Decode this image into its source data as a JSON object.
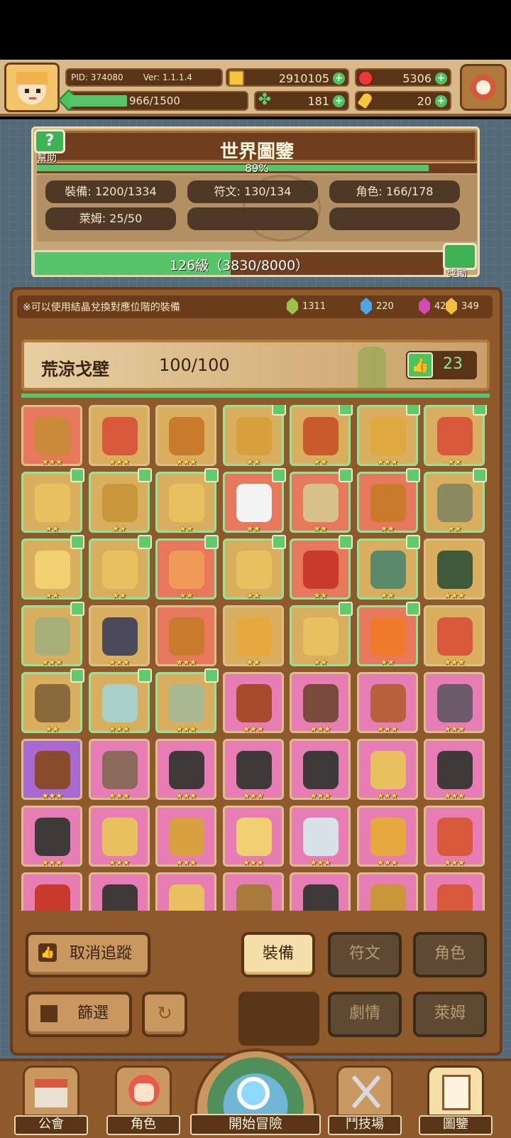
{
  "header": {
    "pid": "PID: 374080",
    "version": "Ver: 1.1.1.4",
    "exp": "966/1500",
    "gold": "2910105",
    "ruby": "5306",
    "clover": "181",
    "keys": "20"
  },
  "book": {
    "help_label": "幫助",
    "title": "世界圖鑒",
    "percent_text": "89%",
    "percent": 0.89,
    "stats": {
      "equipment": "裝備: 1200/1334",
      "runes": "符文: 130/134",
      "characters": "角色: 166/178",
      "slimes": "萊姆: 25/50"
    },
    "level_text": "126級（3830/8000）",
    "level_progress": 0.479,
    "reward_label": "獎勵"
  },
  "collection": {
    "notice": "※可以使用結晶兌換對應位階的裝備",
    "crystals": [
      {
        "color": "#9ac24a",
        "count": "1311"
      },
      {
        "color": "#4aa8e8",
        "count": "220"
      },
      {
        "color": "#d24ab4",
        "count": "42"
      },
      {
        "color": "#f0c040",
        "count": "349"
      }
    ],
    "area_name": "荒涼戈壁",
    "area_progress": "100/100",
    "likes": "23"
  },
  "grid": {
    "rows": [
      [
        {
          "bg": "#e8785c",
          "art": "#c98a3c",
          "stars": "★★★",
          "tracked": false
        },
        {
          "bg": "#d9ae5e",
          "art": "#d8583c",
          "stars": "★★★",
          "tracked": false
        },
        {
          "bg": "#d9ae5e",
          "art": "#c97a2c",
          "stars": "★★★",
          "tracked": false
        },
        {
          "bg": "#d9ae5e",
          "art": "#d8a03c",
          "stars": "★★",
          "tracked": true
        },
        {
          "bg": "#d9ae5e",
          "art": "#c85a2c",
          "stars": "★★",
          "tracked": true
        },
        {
          "bg": "#d9ae5e",
          "art": "#e0a840",
          "stars": "★★★",
          "tracked": true
        },
        {
          "bg": "#d9ae5e",
          "art": "#d8583c",
          "stars": "★★",
          "tracked": true
        }
      ],
      [
        {
          "bg": "#d9ae5e",
          "art": "#e8c060",
          "stars": "★★",
          "tracked": true
        },
        {
          "bg": "#d9ae5e",
          "art": "#c9963c",
          "stars": "★★",
          "tracked": true
        },
        {
          "bg": "#d9ae5e",
          "art": "#e8c060",
          "stars": "★★",
          "tracked": true
        },
        {
          "bg": "#e8785c",
          "art": "#f4f4f4",
          "stars": "★★",
          "tracked": true
        },
        {
          "bg": "#e8785c",
          "art": "#d8c08a",
          "stars": "★★",
          "tracked": true
        },
        {
          "bg": "#e8785c",
          "art": "#c97a2c",
          "stars": "★★",
          "tracked": true
        },
        {
          "bg": "#d9ae5e",
          "art": "#8a8a60",
          "stars": "★★",
          "tracked": true
        }
      ],
      [
        {
          "bg": "#d9ae5e",
          "art": "#f0d070",
          "stars": "★★",
          "tracked": true
        },
        {
          "bg": "#d9ae5e",
          "art": "#e8c060",
          "stars": "★★",
          "tracked": true
        },
        {
          "bg": "#e8785c",
          "art": "#f09a5a",
          "stars": "★★",
          "tracked": true
        },
        {
          "bg": "#d9ae5e",
          "art": "#e8c060",
          "stars": "★★",
          "tracked": true
        },
        {
          "bg": "#e8785c",
          "art": "#c83a2c",
          "stars": "★★",
          "tracked": true
        },
        {
          "bg": "#d9ae5e",
          "art": "#5a8a6a",
          "stars": "★★",
          "tracked": true
        },
        {
          "bg": "#d9ae5e",
          "art": "#3e5a3a",
          "stars": "★★★",
          "tracked": false
        }
      ],
      [
        {
          "bg": "#d9ae5e",
          "art": "#a8b07a",
          "stars": "★★★",
          "tracked": true
        },
        {
          "bg": "#d9ae5e",
          "art": "#4a4a5a",
          "stars": "★★★",
          "tracked": false
        },
        {
          "bg": "#e8785c",
          "art": "#c97a2c",
          "stars": "★★★",
          "tracked": false
        },
        {
          "bg": "#d9ae5e",
          "art": "#e8a840",
          "stars": "★★",
          "tracked": false
        },
        {
          "bg": "#d9ae5e",
          "art": "#e8c060",
          "stars": "★★",
          "tracked": true
        },
        {
          "bg": "#e8785c",
          "art": "#f07a2c",
          "stars": "★★",
          "tracked": true
        },
        {
          "bg": "#d9ae5e",
          "art": "#d8583c",
          "stars": "★★★",
          "tracked": false
        }
      ],
      [
        {
          "bg": "#d9ae5e",
          "art": "#8a6a3c",
          "stars": "★★",
          "tracked": true
        },
        {
          "bg": "#d9ae5e",
          "art": "#a8d0c8",
          "stars": "★★★",
          "tracked": true
        },
        {
          "bg": "#d9ae5e",
          "art": "#a8b890",
          "stars": "★★★",
          "tracked": true
        },
        {
          "bg": "#e87cb4",
          "art": "#a84a2c",
          "stars": "★★★",
          "tracked": false
        },
        {
          "bg": "#e87cb4",
          "art": "#7a4a3c",
          "stars": "★★★",
          "tracked": false
        },
        {
          "bg": "#e87cb4",
          "art": "#b8603c",
          "stars": "★★★",
          "tracked": false
        },
        {
          "bg": "#e87cb4",
          "art": "#6a5a6a",
          "stars": "★★★",
          "tracked": false
        }
      ],
      [
        {
          "bg": "#a86ad0",
          "art": "#8a4a2c",
          "stars": "★★★",
          "tracked": false
        },
        {
          "bg": "#e87cb4",
          "art": "#8a6a5a",
          "stars": "★★★",
          "tracked": false
        },
        {
          "bg": "#e87cb4",
          "art": "#3e3a3a",
          "stars": "★★★",
          "tracked": false
        },
        {
          "bg": "#e87cb4",
          "art": "#3e3a3a",
          "stars": "★★★",
          "tracked": false
        },
        {
          "bg": "#e87cb4",
          "art": "#3e3a3a",
          "stars": "★★★",
          "tracked": false
        },
        {
          "bg": "#e87cb4",
          "art": "#e8c060",
          "stars": "★★★",
          "tracked": false
        },
        {
          "bg": "#e87cb4",
          "art": "#3e3a3a",
          "stars": "★★★",
          "tracked": false
        }
      ],
      [
        {
          "bg": "#e87cb4",
          "art": "#3e3a3a",
          "stars": "★★★",
          "tracked": false
        },
        {
          "bg": "#e87cb4",
          "art": "#e8c060",
          "stars": "★★★",
          "tracked": false
        },
        {
          "bg": "#e87cb4",
          "art": "#d8a040",
          "stars": "★★★",
          "tracked": false
        },
        {
          "bg": "#e87cb4",
          "art": "#f0d070",
          "stars": "★★★",
          "tracked": false
        },
        {
          "bg": "#e87cb4",
          "art": "#d8e0e8",
          "stars": "★★★",
          "tracked": false
        },
        {
          "bg": "#e87cb4",
          "art": "#e8a840",
          "stars": "★★★",
          "tracked": false
        },
        {
          "bg": "#e87cb4",
          "art": "#d8583c",
          "stars": "★★★",
          "tracked": false
        }
      ],
      [
        {
          "bg": "#e87cb4",
          "art": "#c83a2c",
          "stars": "",
          "tracked": false
        },
        {
          "bg": "#e87cb4",
          "art": "#3e3a3a",
          "stars": "",
          "tracked": false
        },
        {
          "bg": "#e87cb4",
          "art": "#e8c060",
          "stars": "",
          "tracked": false
        },
        {
          "bg": "#e87cb4",
          "art": "#a87a3c",
          "stars": "",
          "tracked": false
        },
        {
          "bg": "#e87cb4",
          "art": "#3e3a3a",
          "stars": "",
          "tracked": false
        },
        {
          "bg": "#e87cb4",
          "art": "#c9963c",
          "stars": "",
          "tracked": false
        },
        {
          "bg": "#e87cb4",
          "art": "#d8583c",
          "stars": "",
          "tracked": false
        }
      ]
    ]
  },
  "buttons": {
    "untrack": "取消追蹤",
    "filter": "篩選",
    "equipment": "裝備",
    "runes": "符文",
    "characters": "角色",
    "story": "劇情",
    "slimes": "萊姆"
  },
  "nav": {
    "guild": "公會",
    "character": "角色",
    "adventure": "開始冒險",
    "arena": "鬥技場",
    "codex": "圖鑒"
  }
}
